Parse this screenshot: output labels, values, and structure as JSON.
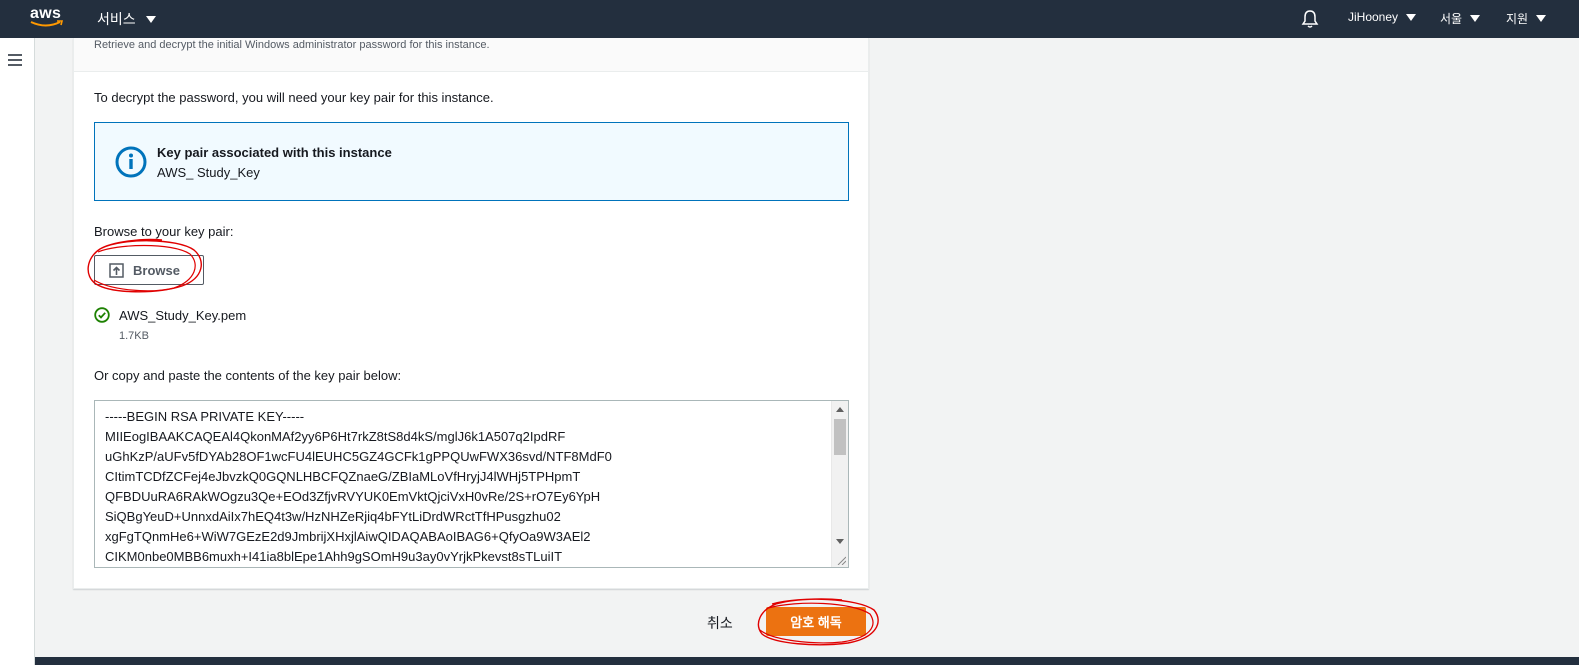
{
  "nav": {
    "logo_text": "aws",
    "services_label": "서비스",
    "user_label": "JiHooney",
    "region_label": "서울",
    "support_label": "지원"
  },
  "panel": {
    "description": "Retrieve and decrypt the initial Windows administrator password for this instance.",
    "decrypt_hint": "To decrypt the password, you will need your key pair for this instance.",
    "info_title": "Key pair associated with this instance",
    "info_value": "AWS_ Study_Key",
    "browse_prompt": "Browse to your key pair:",
    "browse_label": "Browse",
    "file_name": "AWS_Study_Key.pem",
    "file_size": "1.7KB",
    "paste_prompt": "Or copy and paste the contents of the key pair below:",
    "key_lines": [
      "-----BEGIN RSA PRIVATE KEY-----",
      "MIIEogIBAAKCAQEAl4QkonMAf2yy6P6Ht7rkZ8tS8d4kS/mglJ6k1A507q2IpdRF",
      "uGhKzP/aUFv5fDYAb28OF1wcFU4lEUHC5GZ4GCFk1gPPQUwFWX36svd/NTF8MdF0",
      "CItimTCDfZCFej4eJbvzkQ0GQNLHBCFQZnaeG/ZBIaMLoVfHryjJ4lWHj5TPHpmT",
      "QFBDUuRA6RAkWOgzu3Qe+EOd3ZfjvRVYUK0EmVktQjciVxH0vRe/2S+rO7Ey6YpH",
      "SiQBgYeuD+UnnxdAiIx7hEQ4t3w/HzNHZeRjiq4bFYtLiDrdWRctTfHPusgzhu02",
      "xgFgTQnmHe6+WiW7GEzE2d9JmbrijXHxjlAiwQIDAQABAoIBAG6+QfyOa9W3AEl2",
      "CIKM0nbe0MBB6muxh+I41ia8blEpe1Ahh9gSOmH9u3ay0vYrjkPkevst8sTLuiIT"
    ]
  },
  "actions": {
    "cancel_label": "취소",
    "decrypt_label": "암호 해독"
  }
}
